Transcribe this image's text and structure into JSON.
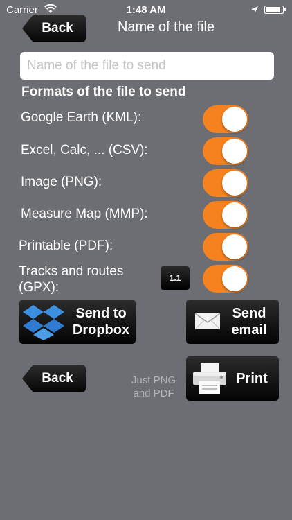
{
  "status_bar": {
    "carrier": "Carrier",
    "time": "1:48 AM"
  },
  "nav": {
    "back_label": "Back",
    "title": "Name of the file"
  },
  "file_name": {
    "value": "",
    "placeholder": "Name of the file to send"
  },
  "formats": {
    "title": "Formats of the file to send",
    "items": [
      {
        "label": "Google Earth (KML):",
        "on": true
      },
      {
        "label": "Excel, Calc, ... (CSV):",
        "on": true
      },
      {
        "label": "Image (PNG):",
        "on": true
      },
      {
        "label": "Measure Map (MMP):",
        "on": true
      },
      {
        "label": "Printable (PDF):",
        "on": true
      },
      {
        "label": "Tracks and routes (GPX):",
        "on": true
      }
    ],
    "gpx_version": "1.1"
  },
  "actions": {
    "dropbox_label": "Send to Dropbox",
    "email_label": "Send email",
    "back_label": "Back",
    "print_hint": "Just PNG and PDF",
    "print_label": "Print"
  },
  "colors": {
    "background": "#6d6e73",
    "toggle_on": "#f5821f",
    "button": "#000000"
  }
}
